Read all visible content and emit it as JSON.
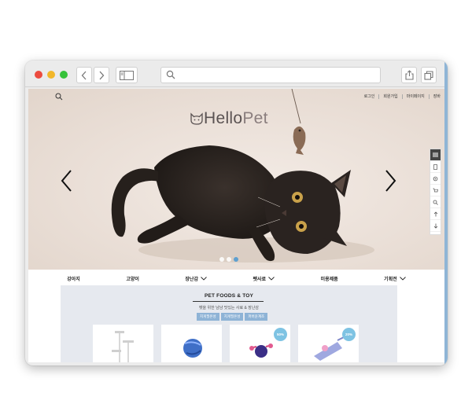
{
  "browser": {
    "toolbar_icons": [
      "back-icon",
      "forward-icon",
      "sidebar-icon",
      "search-icon",
      "share-icon",
      "tabs-icon"
    ]
  },
  "site": {
    "util_nav": [
      "로그인",
      "회원가입",
      "마이페이지",
      "장바"
    ],
    "logo": {
      "hello": "Hello",
      "pet": "Pet"
    },
    "hero_slides": {
      "count": 3,
      "active": 3
    },
    "quick_bar_icons": [
      "menu-icon",
      "phone-icon",
      "gear-icon",
      "cart-icon",
      "search-icon",
      "arrow-up-icon",
      "arrow-down-icon"
    ],
    "category_nav": [
      {
        "label": "강아지",
        "has_dropdown": false
      },
      {
        "label": "고양이",
        "has_dropdown": false
      },
      {
        "label": "장난감",
        "has_dropdown": true
      },
      {
        "label": "펫사료",
        "has_dropdown": true
      },
      {
        "label": "미용제품",
        "has_dropdown": false
      },
      {
        "label": "기획전",
        "has_dropdown": true
      }
    ]
  },
  "section": {
    "title": "PET FOODS & TOY",
    "subtitle": "펫을 위한 냠냠 맛있는 사료 & 장난감",
    "tabs": [
      "지게필온성",
      "지게필온성",
      "퍼버윤계조"
    ],
    "cards": [
      {
        "badge": ""
      },
      {
        "badge": ""
      },
      {
        "badge": "50%"
      },
      {
        "badge": "20%"
      }
    ]
  },
  "colors": {
    "accent": "#8eb3d6",
    "badge": "#7ec3e3",
    "section_bg": "#e6e9ef",
    "active_dot": "#5ea0d0"
  }
}
